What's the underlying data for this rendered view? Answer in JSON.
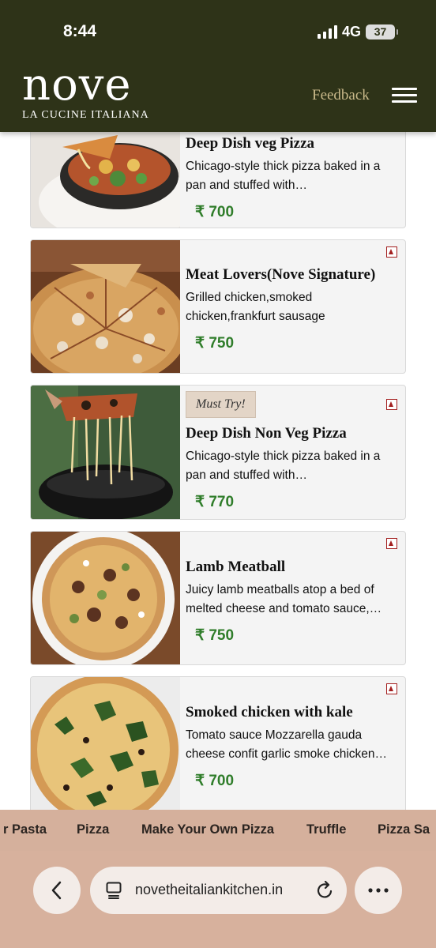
{
  "status": {
    "time": "8:44",
    "network": "4G",
    "battery": "37"
  },
  "header": {
    "logo_word": "nove",
    "logo_sub": "LA CUCINE ITALIANA",
    "feedback_label": "Feedback"
  },
  "items": [
    {
      "title": "Deep Dish veg Pizza",
      "desc": "Chicago-style thick pizza baked in a pan and stuffed with…",
      "price": "₹ 700",
      "badge": "",
      "type": "veg-cut"
    },
    {
      "title": "Meat Lovers(Nove Signature)",
      "desc": "Grilled chicken,smoked chicken,frankfurt sausage",
      "price": "₹ 750",
      "badge": "",
      "type": "non-veg"
    },
    {
      "title": "Deep Dish Non Veg Pizza",
      "desc": "Chicago-style thick pizza baked in a pan and stuffed with…",
      "price": "₹ 770",
      "badge": "Must Try!",
      "type": "non-veg"
    },
    {
      "title": "Lamb Meatball",
      "desc": "Juicy lamb meatballs atop a bed of melted cheese and tomato sauce,…",
      "price": "₹ 750",
      "badge": "",
      "type": "non-veg"
    },
    {
      "title": "Smoked chicken with kale",
      "desc": "Tomato sauce Mozzarella gauda cheese confit garlic smoke chicken…",
      "price": "₹ 700",
      "badge": "",
      "type": "non-veg"
    }
  ],
  "categories": [
    "r Pasta",
    "Pizza",
    "Make Your Own Pizza",
    "Truffle",
    "Pizza Sa"
  ],
  "browser": {
    "url": "novetheitaliankitchen.in"
  },
  "colors": {
    "header_bg": "#2e3318",
    "price_green": "#2f7d2a",
    "nonveg_red": "#a31f1f",
    "category_bar": "#d5b09c"
  }
}
